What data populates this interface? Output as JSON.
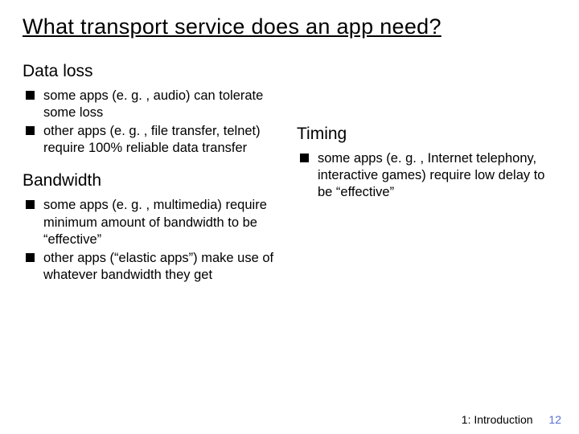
{
  "title": "What transport service does an app need?",
  "left": {
    "section1": {
      "heading": "Data loss",
      "items": [
        "some apps (e. g. , audio) can tolerate some loss",
        "other apps (e. g. , file transfer, telnet) require 100% reliable data transfer"
      ]
    },
    "section2": {
      "heading": "Bandwidth",
      "items": [
        "some apps (e. g. , multimedia) require minimum amount of bandwidth to be “effective”",
        "other apps (“elastic apps”) make use of whatever bandwidth they get"
      ]
    }
  },
  "right": {
    "section1": {
      "heading": "Timing",
      "items": [
        "some apps (e. g. , Internet telephony, interactive games) require low delay to be “effective”"
      ]
    }
  },
  "footer": {
    "chapter": "1: Introduction",
    "page": "12"
  }
}
